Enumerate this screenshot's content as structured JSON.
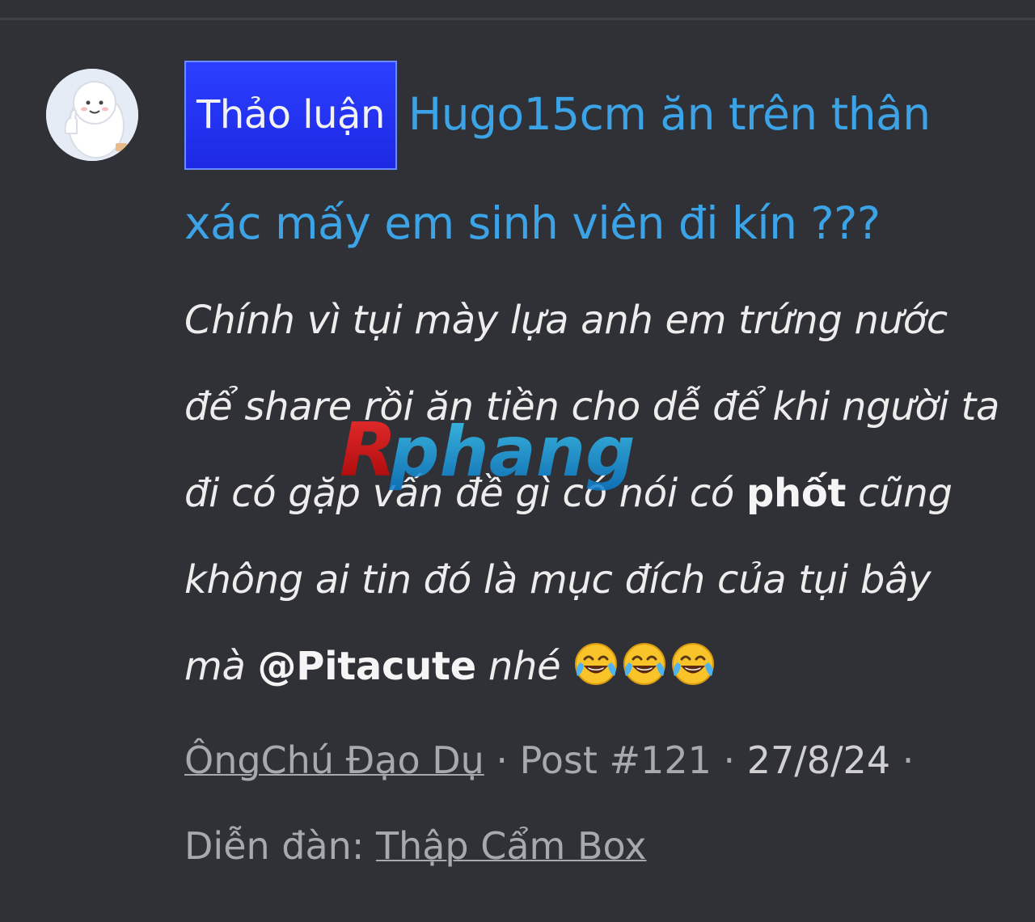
{
  "thread": {
    "prefix": "Thảo luận",
    "title": "Hugo15cm ăn trên thân xác mấy em sinh viên đi kín ???"
  },
  "post": {
    "text_before_bold": "Chính vì tụi mày lựa anh em trứng nước để share rồi ăn tiền cho dễ để khi người ta đi có gặp vấn đề gì có nói có ",
    "bold_word": "phốt",
    "text_after_bold": " cũng không ai tin đó là mục đích của tụi bây mà ",
    "mention": "@Pitacute",
    "text_end": " nhé",
    "emoji_name": "face-with-tears-of-joy-icon",
    "emoji_count": 3
  },
  "meta": {
    "author": "ÔngChú Đạo Dụ",
    "separator": " · ",
    "post_number": "Post #121",
    "date": "27/8/24",
    "trailing_separator": " ·",
    "forum_label": "Diễn đàn: ",
    "forum_name": "Thập Cẩm Box"
  },
  "watermark": {
    "text": "Rphang"
  },
  "colors": {
    "background": "#2f3136",
    "title_link": "#3ba3e6",
    "prefix_badge": "#2233f0",
    "meta_text": "#a8a9ad"
  }
}
